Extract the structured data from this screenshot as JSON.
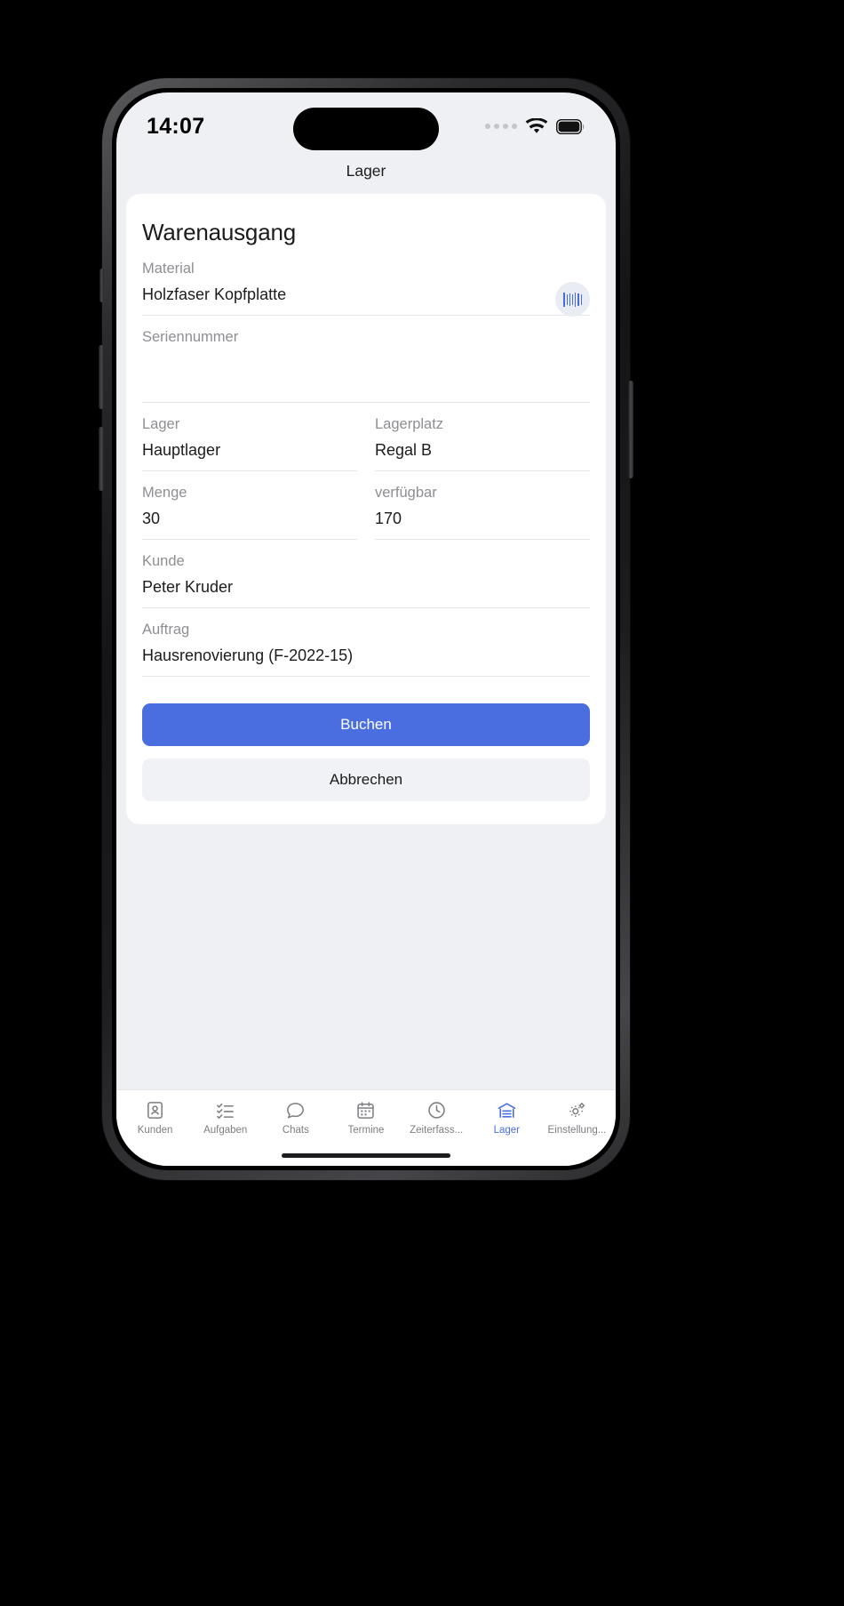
{
  "status_bar": {
    "time": "14:07",
    "wifi_icon": "wifi-icon",
    "battery_icon": "battery-icon",
    "signal_icon": "signal-dots-icon"
  },
  "nav": {
    "title": "Lager"
  },
  "form": {
    "title": "Warenausgang",
    "fields": [
      {
        "label": "Material",
        "value": "Holzfaser Kopfplatte",
        "name": "material"
      },
      {
        "label": "Seriennummer",
        "value": "",
        "name": "seriennummer"
      },
      {
        "label": "Lager",
        "value": "Hauptlager",
        "name": "lager"
      },
      {
        "label": "Lagerplatz",
        "value": "Regal B",
        "name": "lagerplatz"
      },
      {
        "label": "Menge",
        "value": "30",
        "name": "menge"
      },
      {
        "label": "verfügbar",
        "value": "170",
        "name": "verfuegbar"
      },
      {
        "label": "Kunde",
        "value": "Peter Kruder",
        "name": "kunde"
      },
      {
        "label": "Auftrag",
        "value": "Hausrenovierung (F-2022-15)",
        "name": "auftrag"
      }
    ],
    "scan_icon": "barcode-scan-icon",
    "primary_button": "Buchen",
    "secondary_button": "Abbrechen"
  },
  "tab_bar": {
    "items": [
      {
        "label": "Kunden",
        "icon": "contact-card-icon",
        "active": false
      },
      {
        "label": "Aufgaben",
        "icon": "checklist-icon",
        "active": false
      },
      {
        "label": "Chats",
        "icon": "chat-bubble-icon",
        "active": false
      },
      {
        "label": "Termine",
        "icon": "calendar-icon",
        "active": false
      },
      {
        "label": "Zeiterfass...",
        "icon": "clock-icon",
        "active": false
      },
      {
        "label": "Lager",
        "icon": "warehouse-icon",
        "active": true
      },
      {
        "label": "Einstellung...",
        "icon": "gears-icon",
        "active": false
      }
    ]
  },
  "colors": {
    "accent": "#4a6ee0",
    "background": "#eff0f4",
    "card": "#ffffff",
    "label_gray": "#8e8e93",
    "tab_inactive": "#7d7d82"
  }
}
